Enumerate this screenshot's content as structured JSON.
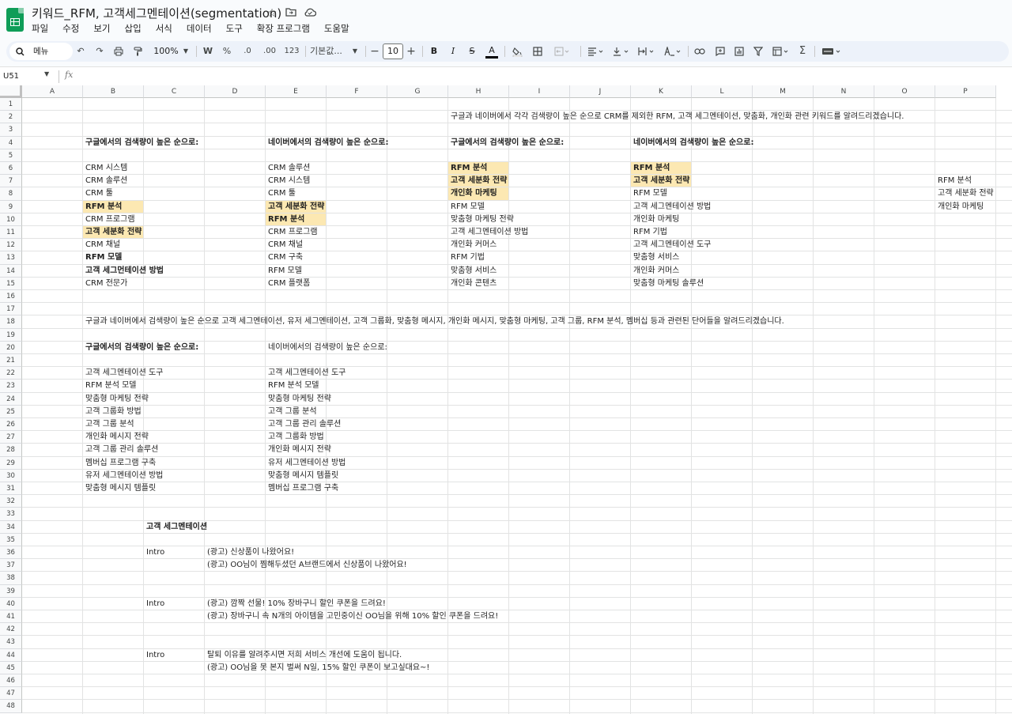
{
  "titlebar": {
    "title": "키워드_RFM, 고객세그멘테이션(segmentation)",
    "icons": [
      "star-icon",
      "folder-move-icon",
      "cloud-icon"
    ]
  },
  "menubar": [
    "파일",
    "수정",
    "보기",
    "삽입",
    "서식",
    "데이터",
    "도구",
    "확장 프로그램",
    "도움말"
  ],
  "toolbar": {
    "search_label": "메뉴",
    "zoom": "100%",
    "currency": "W",
    "percent": "%",
    "decimal_decrease": ".0",
    "decimal_increase": ".00",
    "number_format": "123",
    "font": "기본값...",
    "font_size": "10",
    "bold": "B",
    "italic": "I",
    "strike": "S",
    "text_color": "A",
    "sum": "Σ"
  },
  "formulabar": {
    "name_box": "U51",
    "fx": "fx"
  },
  "columns": [
    "A",
    "B",
    "C",
    "D",
    "E",
    "F",
    "G",
    "H",
    "I",
    "J",
    "K",
    "L",
    "M",
    "N",
    "O",
    "P"
  ],
  "rows": [
    "1",
    "2",
    "3",
    "4",
    "5",
    "6",
    "7",
    "8",
    "9",
    "10",
    "11",
    "12",
    "13",
    "14",
    "15",
    "16",
    "17",
    "18",
    "19",
    "20",
    "21",
    "22",
    "23",
    "24",
    "25",
    "26",
    "27",
    "28",
    "29",
    "30",
    "31",
    "32",
    "33",
    "34",
    "35",
    "36",
    "37",
    "38",
    "39",
    "40",
    "41",
    "42",
    "43",
    "44",
    "45",
    "46",
    "47",
    "48"
  ],
  "highlight_color": "#fce8b2",
  "cells": [
    {
      "r": 2,
      "c": "H",
      "t": "구글과 네이버에서 각각 검색량이 높은 순으로 CRM를 제외한 RFM, 고객 세그멘테이션, 맞춤화, 개인화 관련 키워드를 알려드리겠습니다."
    },
    {
      "r": 4,
      "c": "B",
      "t": "구글에서의 검색량이 높은 순으로:",
      "b": true
    },
    {
      "r": 4,
      "c": "E",
      "t": "네이버에서의 검색량이 높은 순으로:",
      "b": true
    },
    {
      "r": 4,
      "c": "H",
      "t": "구글에서의 검색량이 높은 순으로:",
      "b": true
    },
    {
      "r": 4,
      "c": "K",
      "t": "네이버에서의 검색량이 높은 순으로:",
      "b": true
    },
    {
      "r": 6,
      "c": "B",
      "t": "CRM 시스템"
    },
    {
      "r": 7,
      "c": "B",
      "t": "CRM 솔루션"
    },
    {
      "r": 8,
      "c": "B",
      "t": "CRM 툴"
    },
    {
      "r": 9,
      "c": "B",
      "t": "RFM 분석",
      "b": true,
      "hl": true
    },
    {
      "r": 10,
      "c": "B",
      "t": "CRM 프로그램"
    },
    {
      "r": 11,
      "c": "B",
      "t": "고객 세분화 전략",
      "b": true,
      "hl": true
    },
    {
      "r": 12,
      "c": "B",
      "t": "CRM 채널"
    },
    {
      "r": 13,
      "c": "B",
      "t": "RFM 모델",
      "b": true
    },
    {
      "r": 14,
      "c": "B",
      "t": "고객 세그먼테이션 방법",
      "b": true
    },
    {
      "r": 15,
      "c": "B",
      "t": "CRM 전문가"
    },
    {
      "r": 6,
      "c": "E",
      "t": "CRM 솔루션"
    },
    {
      "r": 7,
      "c": "E",
      "t": "CRM 시스템"
    },
    {
      "r": 8,
      "c": "E",
      "t": "CRM 툴"
    },
    {
      "r": 9,
      "c": "E",
      "t": "고객 세분화 전략",
      "b": true,
      "hl": true
    },
    {
      "r": 10,
      "c": "E",
      "t": "RFM 분석",
      "b": true,
      "hl": true
    },
    {
      "r": 11,
      "c": "E",
      "t": "CRM 프로그램"
    },
    {
      "r": 12,
      "c": "E",
      "t": "CRM 채널"
    },
    {
      "r": 13,
      "c": "E",
      "t": "CRM 구축"
    },
    {
      "r": 14,
      "c": "E",
      "t": "RFM 모델"
    },
    {
      "r": 15,
      "c": "E",
      "t": "CRM 플랫폼"
    },
    {
      "r": 6,
      "c": "H",
      "t": "RFM 분석",
      "b": true,
      "hl": true
    },
    {
      "r": 7,
      "c": "H",
      "t": "고객 세분화 전략",
      "b": true,
      "hl": true
    },
    {
      "r": 8,
      "c": "H",
      "t": "개인화 마케팅",
      "b": true,
      "hl": true
    },
    {
      "r": 9,
      "c": "H",
      "t": "RFM 모델"
    },
    {
      "r": 10,
      "c": "H",
      "t": "맞춤형 마케팅 전략"
    },
    {
      "r": 11,
      "c": "H",
      "t": "고객 세그멘테이션 방법"
    },
    {
      "r": 12,
      "c": "H",
      "t": "개인화 커머스"
    },
    {
      "r": 13,
      "c": "H",
      "t": "RFM 기법"
    },
    {
      "r": 14,
      "c": "H",
      "t": "맞춤형 서비스"
    },
    {
      "r": 15,
      "c": "H",
      "t": "개인화 콘텐츠"
    },
    {
      "r": 6,
      "c": "K",
      "t": "RFM 분석",
      "b": true,
      "hl": true
    },
    {
      "r": 7,
      "c": "K",
      "t": "고객 세분화 전략",
      "b": true,
      "hl": true
    },
    {
      "r": 8,
      "c": "K",
      "t": "RFM 모델"
    },
    {
      "r": 9,
      "c": "K",
      "t": "고객 세그멘테이션 방법"
    },
    {
      "r": 10,
      "c": "K",
      "t": "개인화 마케팅"
    },
    {
      "r": 11,
      "c": "K",
      "t": "RFM 기법"
    },
    {
      "r": 12,
      "c": "K",
      "t": "고객 세그멘테이션 도구"
    },
    {
      "r": 13,
      "c": "K",
      "t": "맞춤형 서비스"
    },
    {
      "r": 14,
      "c": "K",
      "t": "개인화 커머스"
    },
    {
      "r": 15,
      "c": "K",
      "t": "맞춤형 마케팅 솔루션"
    },
    {
      "r": 7,
      "c": "P",
      "t": "RFM 분석"
    },
    {
      "r": 8,
      "c": "P",
      "t": "고객 세분화 전략"
    },
    {
      "r": 9,
      "c": "P",
      "t": "개인화 마케팅"
    },
    {
      "r": 18,
      "c": "B",
      "t": "구글과 네이버에서 검색량이 높은 순으로 고객 세그멘테이션, 유저 세그멘테이션, 고객 그룹화, 맞춤형 메시지, 개인화 메시지, 맞춤형 마케팅, 고객 그룹, RFM 분석, 멤버십 등과 관련된 단어들을 알려드리겠습니다."
    },
    {
      "r": 20,
      "c": "B",
      "t": "구글에서의 검색량이 높은 순으로:",
      "b": true
    },
    {
      "r": 20,
      "c": "E",
      "t": "네이버에서의 검색량이 높은 순으로:"
    },
    {
      "r": 22,
      "c": "B",
      "t": "고객 세그멘테이션 도구"
    },
    {
      "r": 23,
      "c": "B",
      "t": "RFM 분석 모델"
    },
    {
      "r": 24,
      "c": "B",
      "t": "맞춤형 마케팅 전략"
    },
    {
      "r": 25,
      "c": "B",
      "t": "고객 그룹화 방법"
    },
    {
      "r": 26,
      "c": "B",
      "t": "고객 그룹 분석"
    },
    {
      "r": 27,
      "c": "B",
      "t": "개인화 메시지 전략"
    },
    {
      "r": 28,
      "c": "B",
      "t": "고객 그룹 관리 솔루션"
    },
    {
      "r": 29,
      "c": "B",
      "t": "멤버십 프로그램 구축"
    },
    {
      "r": 30,
      "c": "B",
      "t": "유저 세그멘테이션 방법"
    },
    {
      "r": 31,
      "c": "B",
      "t": "맞춤형 메시지 템플릿"
    },
    {
      "r": 22,
      "c": "E",
      "t": "고객 세그멘테이션 도구"
    },
    {
      "r": 23,
      "c": "E",
      "t": "RFM 분석 모델"
    },
    {
      "r": 24,
      "c": "E",
      "t": "맞춤형 마케팅 전략"
    },
    {
      "r": 25,
      "c": "E",
      "t": "고객 그룹 분석"
    },
    {
      "r": 26,
      "c": "E",
      "t": "고객 그룹 관리 솔루션"
    },
    {
      "r": 27,
      "c": "E",
      "t": "고객 그룹화 방법"
    },
    {
      "r": 28,
      "c": "E",
      "t": "개인화 메시지 전략"
    },
    {
      "r": 29,
      "c": "E",
      "t": "유저 세그멘테이션 방법"
    },
    {
      "r": 30,
      "c": "E",
      "t": "맞춤형 메시지 템플릿"
    },
    {
      "r": 31,
      "c": "E",
      "t": "멤버십 프로그램 구축"
    },
    {
      "r": 34,
      "c": "C",
      "t": "고객 세그멘테이션",
      "b": true
    },
    {
      "r": 36,
      "c": "C",
      "t": "Intro"
    },
    {
      "r": 36,
      "c": "D",
      "t": "(광고) 신상품이 나왔어요!"
    },
    {
      "r": 37,
      "c": "D",
      "t": "(광고) OO님이 찜해두셨던 A브랜드에서 신상품이 나왔어요!"
    },
    {
      "r": 40,
      "c": "C",
      "t": "Intro"
    },
    {
      "r": 40,
      "c": "D",
      "t": "(광고) 깜짝 선물! 10% 장바구니 할인 쿠폰을 드려요!"
    },
    {
      "r": 41,
      "c": "D",
      "t": "(광고) 장바구니 속 N개의 아이템을 고민중이신 OO님을 위해 10% 할인 쿠폰을 드려요!"
    },
    {
      "r": 44,
      "c": "C",
      "t": "Intro"
    },
    {
      "r": 44,
      "c": "D",
      "t": "탈퇴 이유를 알려주시면 저희 서비스 개선에 도움이 됩니다."
    },
    {
      "r": 45,
      "c": "D",
      "t": "(광고) OO님을 못 본지 벌써 N일, 15% 할인 쿠폰이 보고싶대요~!"
    }
  ]
}
